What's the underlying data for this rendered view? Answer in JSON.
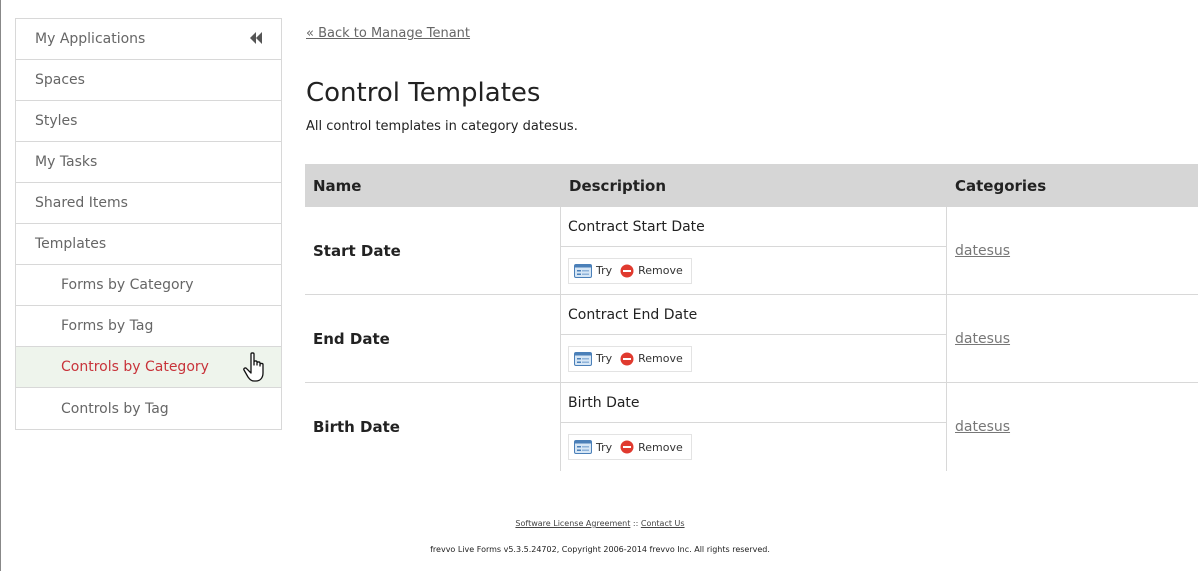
{
  "sidebar": {
    "items": [
      {
        "label": "My Applications"
      },
      {
        "label": "Spaces"
      },
      {
        "label": "Styles"
      },
      {
        "label": "My Tasks"
      },
      {
        "label": "Shared Items"
      },
      {
        "label": "Templates"
      },
      {
        "label": "Forms by Category"
      },
      {
        "label": "Forms by Tag"
      },
      {
        "label": "Controls by Category"
      },
      {
        "label": "Controls by Tag"
      }
    ],
    "active_color": "#c8333a"
  },
  "main": {
    "back_link": "« Back to Manage Tenant",
    "title": "Control Templates",
    "subtitle": "All control templates in category datesus."
  },
  "table": {
    "headers": [
      "Name",
      "Description",
      "Categories"
    ],
    "rows": [
      {
        "name": "Start Date",
        "description": "Contract Start Date",
        "try": "Try",
        "remove": "Remove",
        "category": "datesus"
      },
      {
        "name": "End Date",
        "description": "Contract End Date",
        "try": "Try",
        "remove": "Remove",
        "category": "datesus"
      },
      {
        "name": "Birth Date",
        "description": "Birth Date",
        "try": "Try",
        "remove": "Remove",
        "category": "datesus"
      }
    ]
  },
  "footer": {
    "license_link": "Software License Agreement",
    "separator": "::",
    "contact_link": "Contact Us",
    "copyright": "frevvo Live Forms v5.3.5.24702, Copyright 2006-2014 frevvo Inc. All rights reserved."
  }
}
